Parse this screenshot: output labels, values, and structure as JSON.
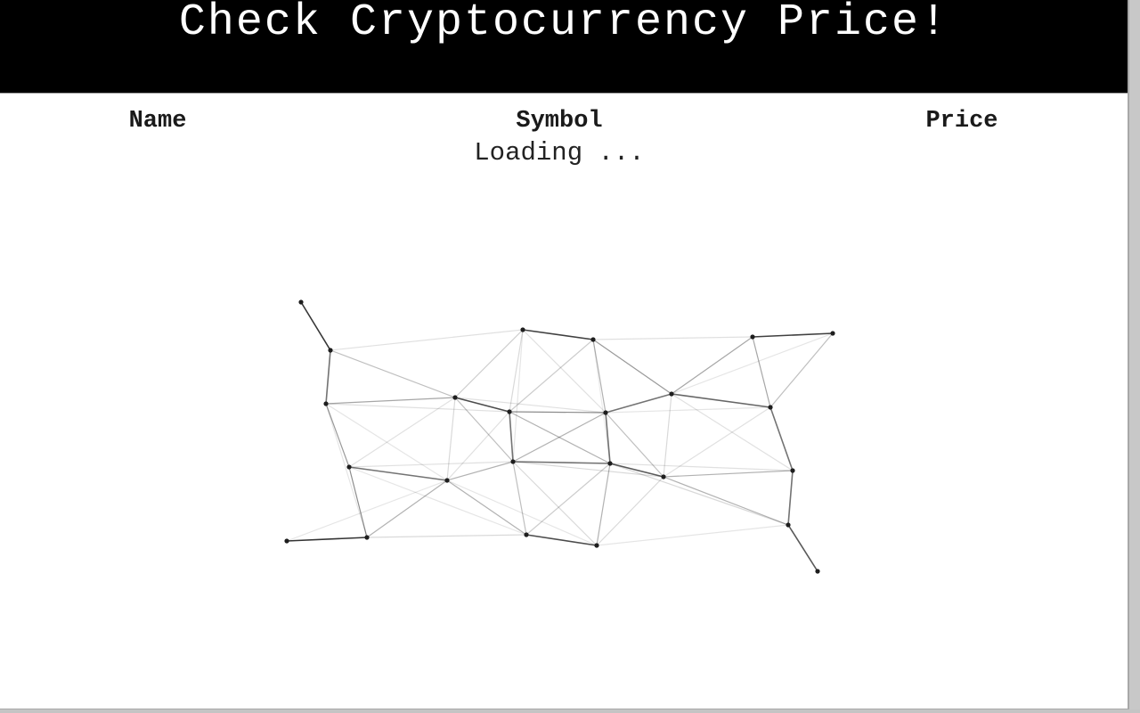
{
  "header": {
    "title": "Check Cryptocurrency Price!"
  },
  "table": {
    "columns": [
      "Name",
      "Symbol",
      "Price"
    ],
    "status": "Loading ..."
  },
  "loader": {
    "icon": "network-graph-spinner",
    "color": "#000000"
  }
}
